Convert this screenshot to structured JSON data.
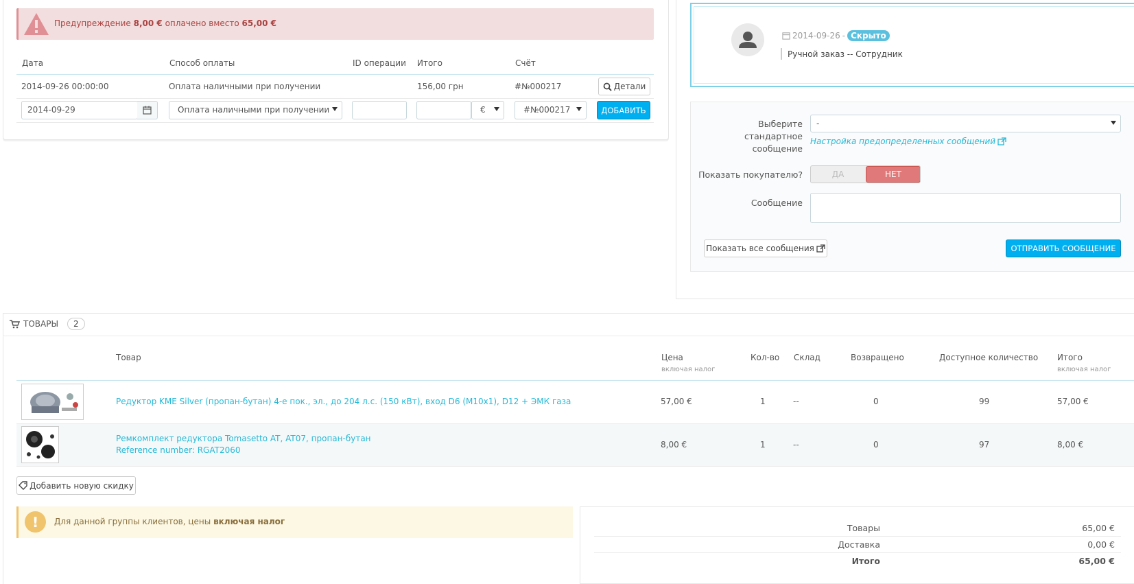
{
  "payment": {
    "alert": {
      "prefix": "Предупреждение",
      "paid": "8,00 €",
      "middle": "оплачено вместо",
      "expected": "65,00 €"
    },
    "headers": {
      "date": "Дата",
      "method": "Способ оплаты",
      "transaction": "ID операции",
      "total": "Итого",
      "invoice": "Счёт"
    },
    "row": {
      "date": "2014-09-26 00:00:00",
      "method": "Оплата наличными при получении",
      "transaction": "",
      "total": "156,00 грн",
      "invoice": "#№000217",
      "details_label": "Детали"
    },
    "new_row": {
      "date": "2014-09-29",
      "method": "Оплата наличными при получении",
      "transaction": "",
      "amount": "",
      "currency": "€",
      "invoice": "#№000217",
      "add_label": "ДОБАВИТЬ"
    }
  },
  "messages": {
    "last": {
      "date": "2014-09-26",
      "separator": "-",
      "visibility": "Скрыто",
      "text": "Ручной заказ -- Сотрудник"
    },
    "form": {
      "choose_label": "Выберите стандартное сообщение",
      "choose_value": "-",
      "config_link": "Настройка предопределенных сообщений",
      "show_customer_label": "Показать покупателю?",
      "yes_label": "ДА",
      "no_label": "НЕТ",
      "message_label": "Сообщение",
      "message_value": "",
      "show_all_label": "Показать все сообщения",
      "send_label": "ОТПРАВИТЬ СООБЩЕНИЕ"
    }
  },
  "products": {
    "title": "ТОВАРЫ",
    "count": "2",
    "headers": {
      "product": "Товар",
      "price": "Цена",
      "price_sub": "включая налог",
      "qty": "Кол-во",
      "warehouse": "Склад",
      "returned": "Возвращено",
      "available": "Доступное количество",
      "total": "Итого",
      "total_sub": "включая налог"
    },
    "rows": [
      {
        "name": "Редуктор KME Silver (пропан-бутан) 4-е пок., эл., до 204 л.с. (150 кВт), вход D6 (M10x1), D12 + ЭМК газа",
        "reference": "",
        "price": "57,00 €",
        "qty": "1",
        "warehouse": "--",
        "returned": "0",
        "available": "99",
        "total": "57,00 €"
      },
      {
        "name": "Ремкомплект редуктора Tomasetto AT, AT07, пропан-бутан",
        "reference": "Reference number: RGAT2060",
        "price": "8,00 €",
        "qty": "1",
        "warehouse": "--",
        "returned": "0",
        "available": "97",
        "total": "8,00 €"
      }
    ],
    "add_discount_label": "Добавить новую скидку",
    "tax_alert": {
      "prefix": "Для данной группы клиентов, цены",
      "bold": "включая налог"
    },
    "totals": [
      {
        "label": "Товары",
        "value": "65,00 €"
      },
      {
        "label": "Доставка",
        "value": "0,00 €"
      },
      {
        "label": "Итого",
        "value": "65,00 €"
      }
    ]
  },
  "colors": {
    "primary": "#00aff0",
    "danger_bg": "#f2dede",
    "warning_bg": "#fcf8e3",
    "link": "#25b9d7",
    "toggle_no": "#e07979"
  }
}
